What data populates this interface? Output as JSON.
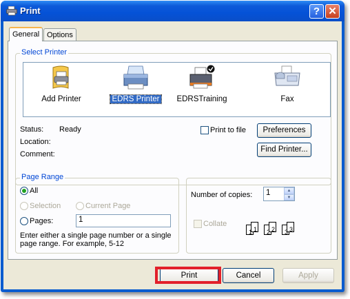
{
  "window": {
    "title": "Print",
    "help_glyph": "?",
    "close_glyph": "✕"
  },
  "tabs": [
    {
      "label": "General",
      "active": true
    },
    {
      "label": "Options",
      "active": false
    }
  ],
  "select_printer": {
    "group_label": "Select Printer",
    "printers": [
      {
        "label": "Add Printer",
        "icon": "add-printer-icon",
        "selected": false
      },
      {
        "label": "EDRS Printer",
        "icon": "printer-icon",
        "selected": true
      },
      {
        "label": "EDRSTraining",
        "icon": "default-printer-icon",
        "selected": false
      },
      {
        "label": "Fax",
        "icon": "fax-icon",
        "selected": false
      }
    ],
    "status_label": "Status:",
    "status_value": "Ready",
    "location_label": "Location:",
    "location_value": "",
    "comment_label": "Comment:",
    "comment_value": "",
    "print_to_file_label": "Print to file",
    "print_to_file_checked": false,
    "preferences_label": "Preferences",
    "find_printer_label": "Find Printer..."
  },
  "page_range": {
    "group_label": "Page Range",
    "all_label": "All",
    "selection_label": "Selection",
    "current_page_label": "Current Page",
    "pages_label": "Pages:",
    "pages_value": "1",
    "selected_option": "All",
    "hint": "Enter either a single page number or a single page range.  For example, 5-12"
  },
  "copies": {
    "label": "Number of copies:",
    "value": "1",
    "collate_label": "Collate",
    "collate_checked": false,
    "collate_page_numbers": [
      "1",
      "1",
      "2",
      "2",
      "3",
      "3"
    ]
  },
  "footer": {
    "print_label": "Print",
    "cancel_label": "Cancel",
    "apply_label": "Apply"
  },
  "colors": {
    "titlebar": "#0552d7",
    "group_label": "#0046d5",
    "selection": "#316ac5",
    "highlight_box": "#e2202a"
  }
}
